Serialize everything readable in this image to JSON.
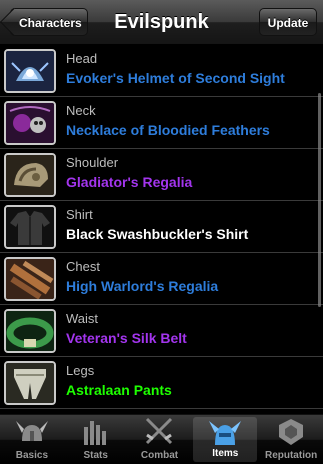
{
  "navbar": {
    "title": "Evilspunk",
    "back_label": "Characters",
    "update_label": "Update"
  },
  "items": [
    {
      "slot": "Head",
      "name": "Evoker's Helmet of Second Sight",
      "color": "#2e7ddb",
      "icon": "helmet-icon"
    },
    {
      "slot": "Neck",
      "name": "Necklace of Bloodied Feathers",
      "color": "#2e7ddb",
      "icon": "necklace-icon"
    },
    {
      "slot": "Shoulder",
      "name": "Gladiator's Regalia",
      "color": "#a335ee",
      "icon": "shoulder-icon"
    },
    {
      "slot": "Shirt",
      "name": "Black Swashbuckler's Shirt",
      "color": "#ffffff",
      "icon": "shirt-icon"
    },
    {
      "slot": "Chest",
      "name": "High Warlord's Regalia",
      "color": "#2e7ddb",
      "icon": "chest-icon"
    },
    {
      "slot": "Waist",
      "name": "Veteran's Silk Belt",
      "color": "#a335ee",
      "icon": "belt-icon"
    },
    {
      "slot": "Legs",
      "name": "Astralaan Pants",
      "color": "#1eff00",
      "icon": "legs-icon"
    },
    {
      "slot": "",
      "name": "",
      "color": "#ffffff",
      "icon": "boots-icon"
    }
  ],
  "tabs": [
    {
      "label": "Basics",
      "icon": "viking-helmet-icon",
      "active": false
    },
    {
      "label": "Stats",
      "icon": "bar-chart-icon",
      "active": false
    },
    {
      "label": "Combat",
      "icon": "crossed-swords-icon",
      "active": false
    },
    {
      "label": "Items",
      "icon": "armor-helmet-icon",
      "active": true
    },
    {
      "label": "Reputation",
      "icon": "reputation-emblem-icon",
      "active": false
    }
  ]
}
